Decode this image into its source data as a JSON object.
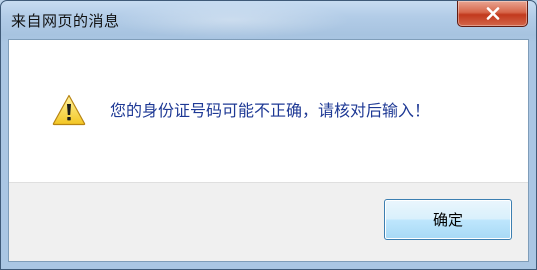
{
  "window": {
    "title": "来自网页的消息"
  },
  "dialog": {
    "message": "您的身份证号码可能不正确，请核对后输入！",
    "icon": "warning-icon",
    "ok_label": "确定"
  },
  "colors": {
    "message_text": "#1e3995",
    "close_button": "#c2391d",
    "ok_button_border": "#3c7fb1"
  }
}
